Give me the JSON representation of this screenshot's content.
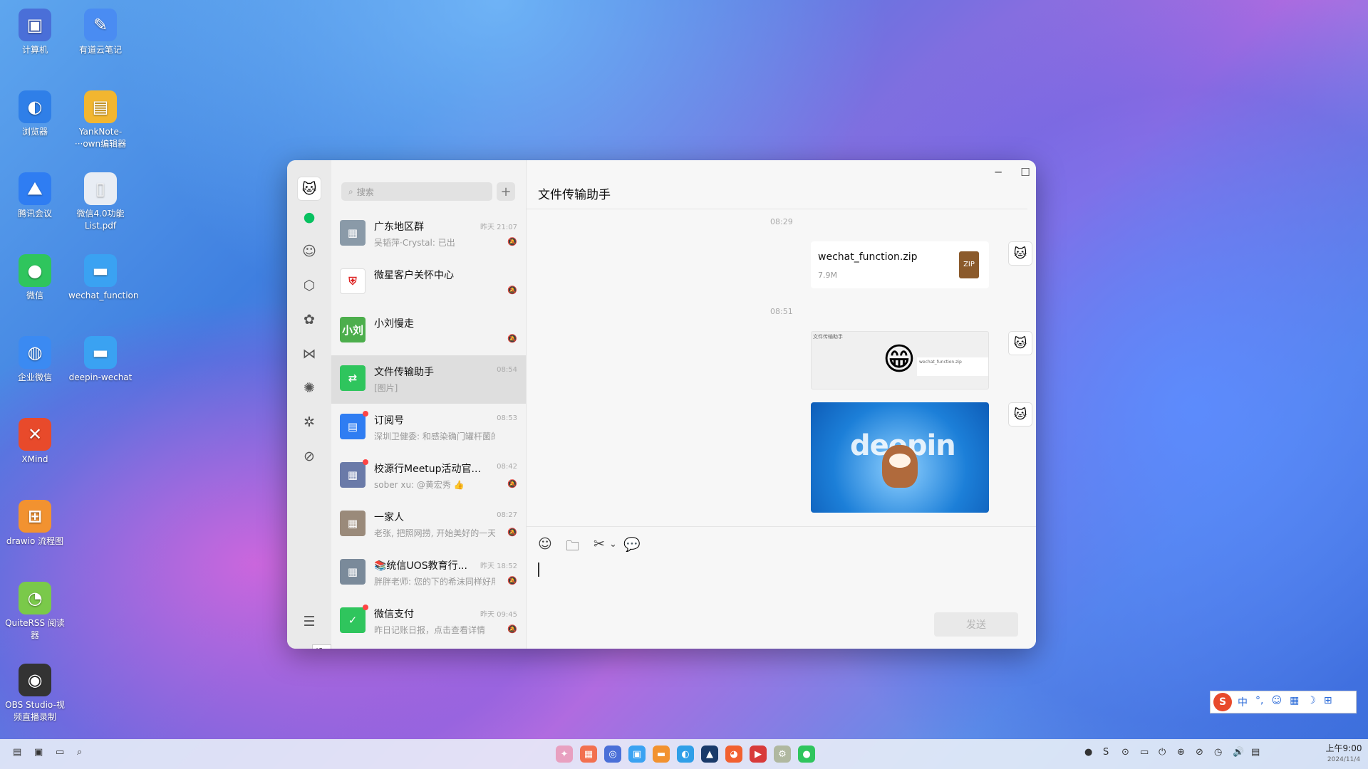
{
  "desktop": {
    "icons": [
      {
        "label": "计算机",
        "symbol": "▣",
        "color": "#4a6fd8"
      },
      {
        "label": "有道云笔记",
        "symbol": "✎",
        "color": "#4a8cf2"
      },
      {
        "label": "浏览器",
        "symbol": "◐",
        "color": "#2f7fe8"
      },
      {
        "label": "YankNote-···own编辑器",
        "symbol": "▤",
        "color": "#f2b630"
      },
      {
        "label": "腾讯会议",
        "symbol": "⛰",
        "color": "#2f7df2"
      },
      {
        "label": "微信4.0功能List.pdf",
        "symbol": "▯",
        "color": "#e8edf4"
      },
      {
        "label": "微信",
        "symbol": "●",
        "color": "#2fc55d"
      },
      {
        "label": "wechat_function",
        "symbol": "▬",
        "color": "#3aa2f2"
      },
      {
        "label": "企业微信",
        "symbol": "◍",
        "color": "#3b8af2"
      },
      {
        "label": "deepin-wechat",
        "symbol": "▬",
        "color": "#3aa2f2"
      },
      {
        "label": "XMind",
        "symbol": "✕",
        "color": "#e84a2b"
      },
      {
        "label": "drawio 流程图",
        "symbol": "⊞",
        "color": "#f29230"
      },
      {
        "label": "QuiteRSS 阅读器",
        "symbol": "◔",
        "color": "#7ac94a"
      },
      {
        "label": "OBS Studio-视频直播录制",
        "symbol": "◉",
        "color": "#333333"
      }
    ]
  },
  "nav": {
    "avatar_icon": "cat-avatar",
    "items": [
      {
        "name": "chats",
        "symbol": "●",
        "active": true
      },
      {
        "name": "contacts",
        "symbol": "☺"
      },
      {
        "name": "favorites",
        "symbol": "⬡"
      },
      {
        "name": "moments",
        "symbol": "✿"
      },
      {
        "name": "channels",
        "symbol": "⋈"
      },
      {
        "name": "mini-programs",
        "symbol": "✺"
      },
      {
        "name": "search",
        "symbol": "✲"
      },
      {
        "name": "phone",
        "symbol": "⊘"
      }
    ],
    "menu_symbol": "☰",
    "tooltip": "设置"
  },
  "list": {
    "search_placeholder": "搜索",
    "add_symbol": "+",
    "chats": [
      {
        "name": "广东地区群",
        "preview": "吴韬萍·Crystal: 已出",
        "time": "昨天 21:07",
        "muted": true,
        "avatar_color": "#8a9aa8",
        "avatar_text": "▦"
      },
      {
        "name": "微星客户关怀中心",
        "preview": "",
        "time": "",
        "muted": true,
        "avatar_color": "#ffffff",
        "avatar_text": "⛨"
      },
      {
        "name": "小刘慢走",
        "preview": "",
        "time": "",
        "muted": true,
        "avatar_color": "#4cae4c",
        "avatar_text": "小刘"
      },
      {
        "name": "文件传输助手",
        "preview": "[图片]",
        "time": "08:54",
        "muted": false,
        "avatar_color": "#2fc55d",
        "avatar_text": "⇄",
        "active": true
      },
      {
        "name": "订阅号",
        "preview": "深圳卫健委: 和感染确门罐杆菌的人...",
        "time": "08:53",
        "muted": false,
        "avatar_color": "#2f7df2",
        "avatar_text": "▤",
        "unread": true
      },
      {
        "name": "校源行Meetup活动官...",
        "preview": "sober xu: @黄宏秀 👍",
        "time": "08:42",
        "muted": true,
        "avatar_color": "#6a7aa8",
        "avatar_text": "▦",
        "unread": true
      },
      {
        "name": "一家人",
        "preview": "老张, 把照网捞, 开始美好的一天...",
        "time": "08:27",
        "muted": true,
        "avatar_color": "#9a8a7a",
        "avatar_text": "▦"
      },
      {
        "name": "📚统信UOS教育行...",
        "preview": "胖胖老师: 您的下的希沫同样好用...",
        "time": "昨天 18:52",
        "muted": true,
        "avatar_color": "#7a8a9a",
        "avatar_text": "▦"
      },
      {
        "name": "微信支付",
        "preview": "昨日记账日报，点击查看详情",
        "time": "昨天 09:45",
        "muted": true,
        "avatar_color": "#2fc55d",
        "avatar_text": "✓",
        "unread": true
      }
    ]
  },
  "chat": {
    "title": "文件传输助手",
    "window_controls": {
      "minimize": "─",
      "maximize": "☐",
      "close": "✕"
    },
    "timestamps": [
      "08:29",
      "08:51"
    ],
    "file_message": {
      "name": "wechat_function.zip",
      "size": "7.9M",
      "icon": "zip-file-icon"
    },
    "screenshot_message": {
      "mini_title": "文件传输助手",
      "emoji": "😁",
      "mini_file": "wechat_function.zip"
    },
    "image_message": {
      "text": "deepin"
    },
    "toolbar": {
      "emoji": "☺",
      "folder": "🗀",
      "scissors": "✂",
      "chevron": "⌄",
      "chat": "💬"
    },
    "send_label": "发送"
  },
  "ime": {
    "logo": "S",
    "items": [
      "中",
      "°,",
      "☺",
      "▦",
      "☽",
      "⊞"
    ]
  },
  "taskbar": {
    "left": [
      "▤",
      "▣",
      "▭",
      "⌕"
    ],
    "apps": [
      {
        "symbol": "✦",
        "color": "#e8a0c0"
      },
      {
        "symbol": "▦",
        "color": "#f27050"
      },
      {
        "symbol": "◎",
        "color": "#4a6fd8"
      },
      {
        "symbol": "▣",
        "color": "#3aa2f2"
      },
      {
        "symbol": "▬",
        "color": "#f29230"
      },
      {
        "symbol": "◐",
        "color": "#2f9fe8"
      },
      {
        "symbol": "▲",
        "color": "#1a3a6a"
      },
      {
        "symbol": "◕",
        "color": "#f26030"
      },
      {
        "symbol": "▶",
        "color": "#d83a3a"
      },
      {
        "symbol": "⚙",
        "color": "#b0b8a0"
      },
      {
        "symbol": "●",
        "color": "#2fc55d"
      }
    ],
    "tray": [
      "●",
      "S",
      "⊙",
      "▭",
      "⏻",
      "⊕",
      "⊘",
      "◷",
      "🔊",
      "▤"
    ],
    "clock_time": "上午9:00",
    "clock_date": "2024/11/4"
  }
}
